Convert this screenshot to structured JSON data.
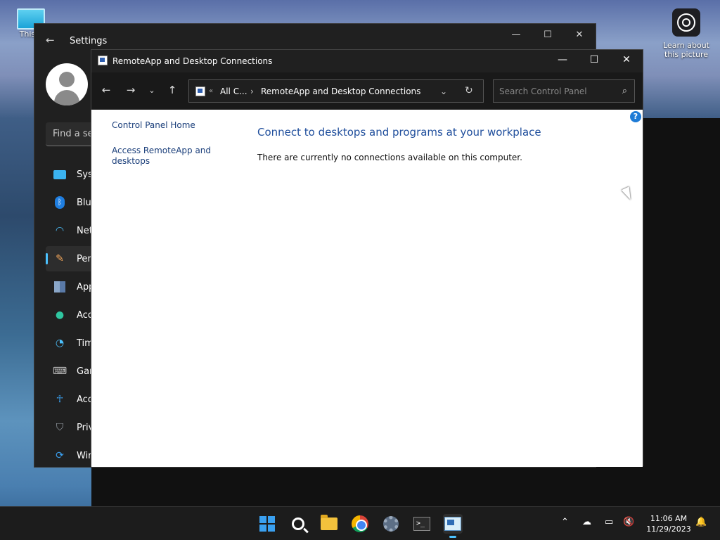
{
  "desktop": {
    "this_pc_label": "This P",
    "learn_label": "Learn about this picture"
  },
  "settings": {
    "title": "Settings",
    "search_placeholder": "Find a se",
    "nav": [
      {
        "label": "Syst",
        "icon": "monitor-icon"
      },
      {
        "label": "Blue",
        "icon": "bluetooth-icon"
      },
      {
        "label": "Net",
        "icon": "wifi-icon"
      },
      {
        "label": "Pers",
        "icon": "brush-icon"
      },
      {
        "label": "App",
        "icon": "apps-icon"
      },
      {
        "label": "Acc",
        "icon": "person-icon"
      },
      {
        "label": "Tim",
        "icon": "clock-globe-icon"
      },
      {
        "label": "Gar",
        "icon": "gamepad-icon"
      },
      {
        "label": "Acc",
        "icon": "accessibility-icon"
      },
      {
        "label": "Priv",
        "icon": "shield-icon"
      },
      {
        "label": "Wir",
        "icon": "update-icon"
      }
    ]
  },
  "cp": {
    "title": "RemoteApp and Desktop Connections",
    "breadcrumb_root": "All C...",
    "breadcrumb_current": "RemoteApp and Desktop Connections",
    "search_placeholder": "Search Control Panel",
    "links": {
      "home": "Control Panel Home",
      "access": "Access RemoteApp and desktops"
    },
    "heading": "Connect to desktops and programs at your workplace",
    "message": "There are currently no connections available on this computer."
  },
  "taskbar": {
    "time": "11:06 AM",
    "date": "11/29/2023"
  }
}
